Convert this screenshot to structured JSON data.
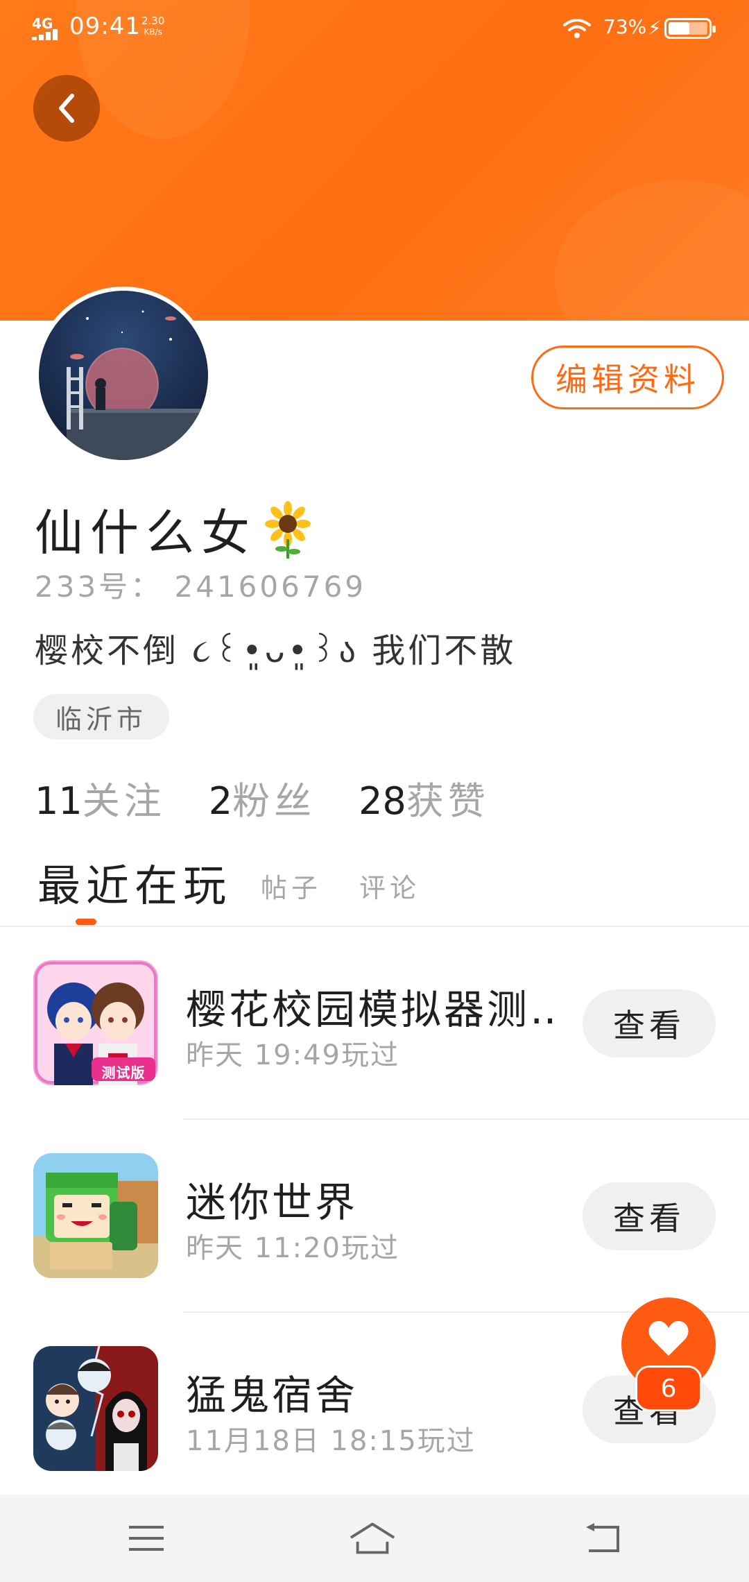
{
  "status_bar": {
    "network": "4G",
    "time": "09:41",
    "speed_value": "2.30",
    "speed_unit": "KB/s",
    "battery_percent": "73%"
  },
  "profile": {
    "nickname": "仙什么女",
    "uid": "233号：  241606769",
    "bio": "樱校不倒  ૮꒰•͈ᴗ•͈꒱ა  我们不散",
    "location": "临沂市",
    "edit_label": "编辑资料"
  },
  "stats": [
    {
      "value": "11",
      "label": "关注"
    },
    {
      "value": "2",
      "label": "粉丝"
    },
    {
      "value": "28",
      "label": "获赞"
    }
  ],
  "tabs": {
    "recent": "最近在玩",
    "posts": "帖子",
    "comments": "评论"
  },
  "games": [
    {
      "title": "樱花校园模拟器测…",
      "played": "昨天 19:49玩过",
      "action": "查看",
      "icon_badge": "测试版"
    },
    {
      "title": "迷你世界",
      "played": "昨天 11:20玩过",
      "action": "查看"
    },
    {
      "title": "猛鬼宿舍",
      "played": "11月18日 18:15玩过",
      "action": "查看"
    }
  ],
  "fab": {
    "badge_count": "6"
  },
  "colors": {
    "accent": "#ff6a13",
    "banner": "#ff7a1a",
    "muted_text": "#a6a6a6"
  }
}
